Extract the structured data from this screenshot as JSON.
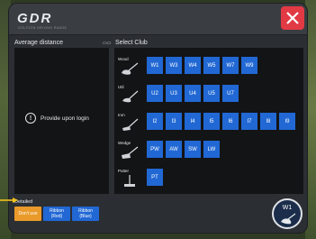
{
  "header": {
    "logo": "GDR",
    "logo_sub": "GOLFZON DRIVING RANGE"
  },
  "average": {
    "title": "Average distance",
    "message": "Provide upon login"
  },
  "clubs": {
    "title": "Select Club",
    "rows": [
      {
        "label": "Wood",
        "buttons": [
          "W1",
          "W3",
          "W4",
          "W5",
          "W7",
          "W9"
        ]
      },
      {
        "label": "Util",
        "buttons": [
          "U2",
          "U3",
          "U4",
          "U5",
          "U7"
        ]
      },
      {
        "label": "Iron",
        "buttons": [
          "I2",
          "I3",
          "I4",
          "I5",
          "I6",
          "I7",
          "I8",
          "I9"
        ]
      },
      {
        "label": "Wedge",
        "buttons": [
          "PW",
          "AW",
          "SW",
          "LW"
        ]
      },
      {
        "label": "Putter",
        "buttons": [
          "PT"
        ]
      }
    ]
  },
  "detailed": {
    "label": "Detailed",
    "dont_use": "Don't use",
    "ribbon_red_1": "Ribbon",
    "ribbon_red_2": "(Red)",
    "ribbon_blue_1": "Ribbon",
    "ribbon_blue_2": "(Blue)"
  },
  "current_club": "W1",
  "colors": {
    "button_blue": "#2168d4",
    "button_orange": "#e99a2a",
    "close_red": "#e23a44"
  }
}
